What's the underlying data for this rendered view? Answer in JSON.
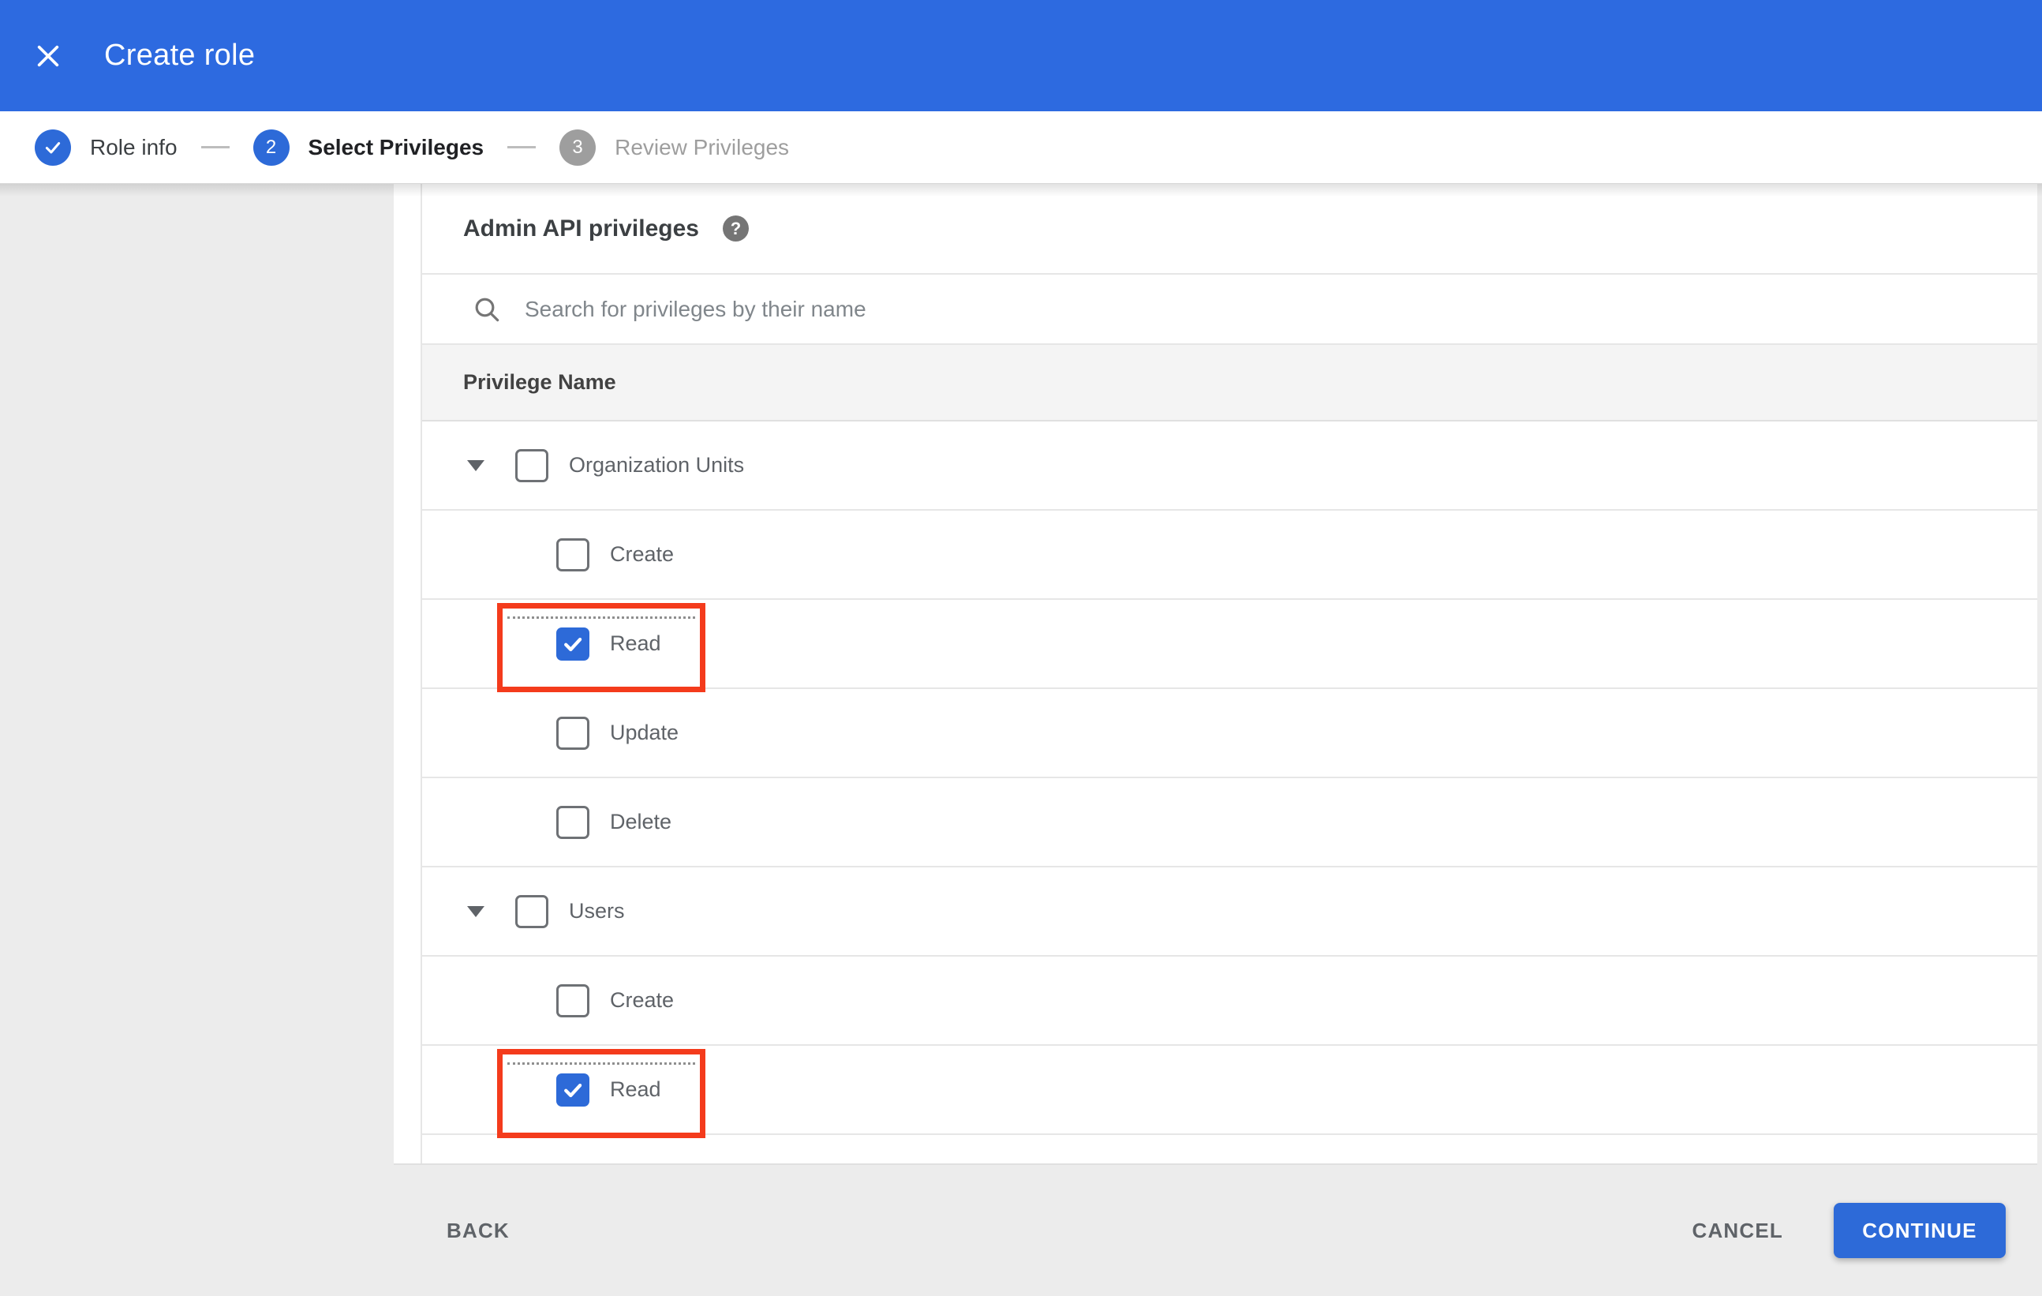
{
  "colors": {
    "header_blue": "#2d6ae0",
    "accent_blue": "#2d6ad8",
    "highlight_red": "#f43b1c",
    "inactive_gray": "#9e9e9e",
    "page_background": "#ececec"
  },
  "header": {
    "title": "Create role"
  },
  "stepper": {
    "steps": [
      {
        "number": "1",
        "label": "Role info",
        "state": "completed"
      },
      {
        "number": "2",
        "label": "Select Privileges",
        "state": "active"
      },
      {
        "number": "3",
        "label": "Review Privileges",
        "state": "upcoming"
      }
    ]
  },
  "privileges_panel": {
    "title": "Admin API privileges",
    "help_glyph": "?",
    "search": {
      "placeholder": "Search for privileges by their name",
      "value": ""
    },
    "table": {
      "header": "Privilege Name",
      "rows": [
        {
          "label": "Organization Units",
          "level": 0,
          "expanded": true,
          "checked": false,
          "highlighted": false
        },
        {
          "label": "Create",
          "level": 1,
          "checked": false,
          "highlighted": false
        },
        {
          "label": "Read",
          "level": 1,
          "checked": true,
          "highlighted": true
        },
        {
          "label": "Update",
          "level": 1,
          "checked": false,
          "highlighted": false
        },
        {
          "label": "Delete",
          "level": 1,
          "checked": false,
          "highlighted": false
        },
        {
          "label": "Users",
          "level": 0,
          "expanded": true,
          "checked": false,
          "highlighted": false
        },
        {
          "label": "Create",
          "level": 1,
          "checked": false,
          "highlighted": false
        },
        {
          "label": "Read",
          "level": 1,
          "checked": true,
          "highlighted": true
        }
      ]
    }
  },
  "footer": {
    "back_label": "BACK",
    "cancel_label": "CANCEL",
    "continue_label": "CONTINUE"
  }
}
